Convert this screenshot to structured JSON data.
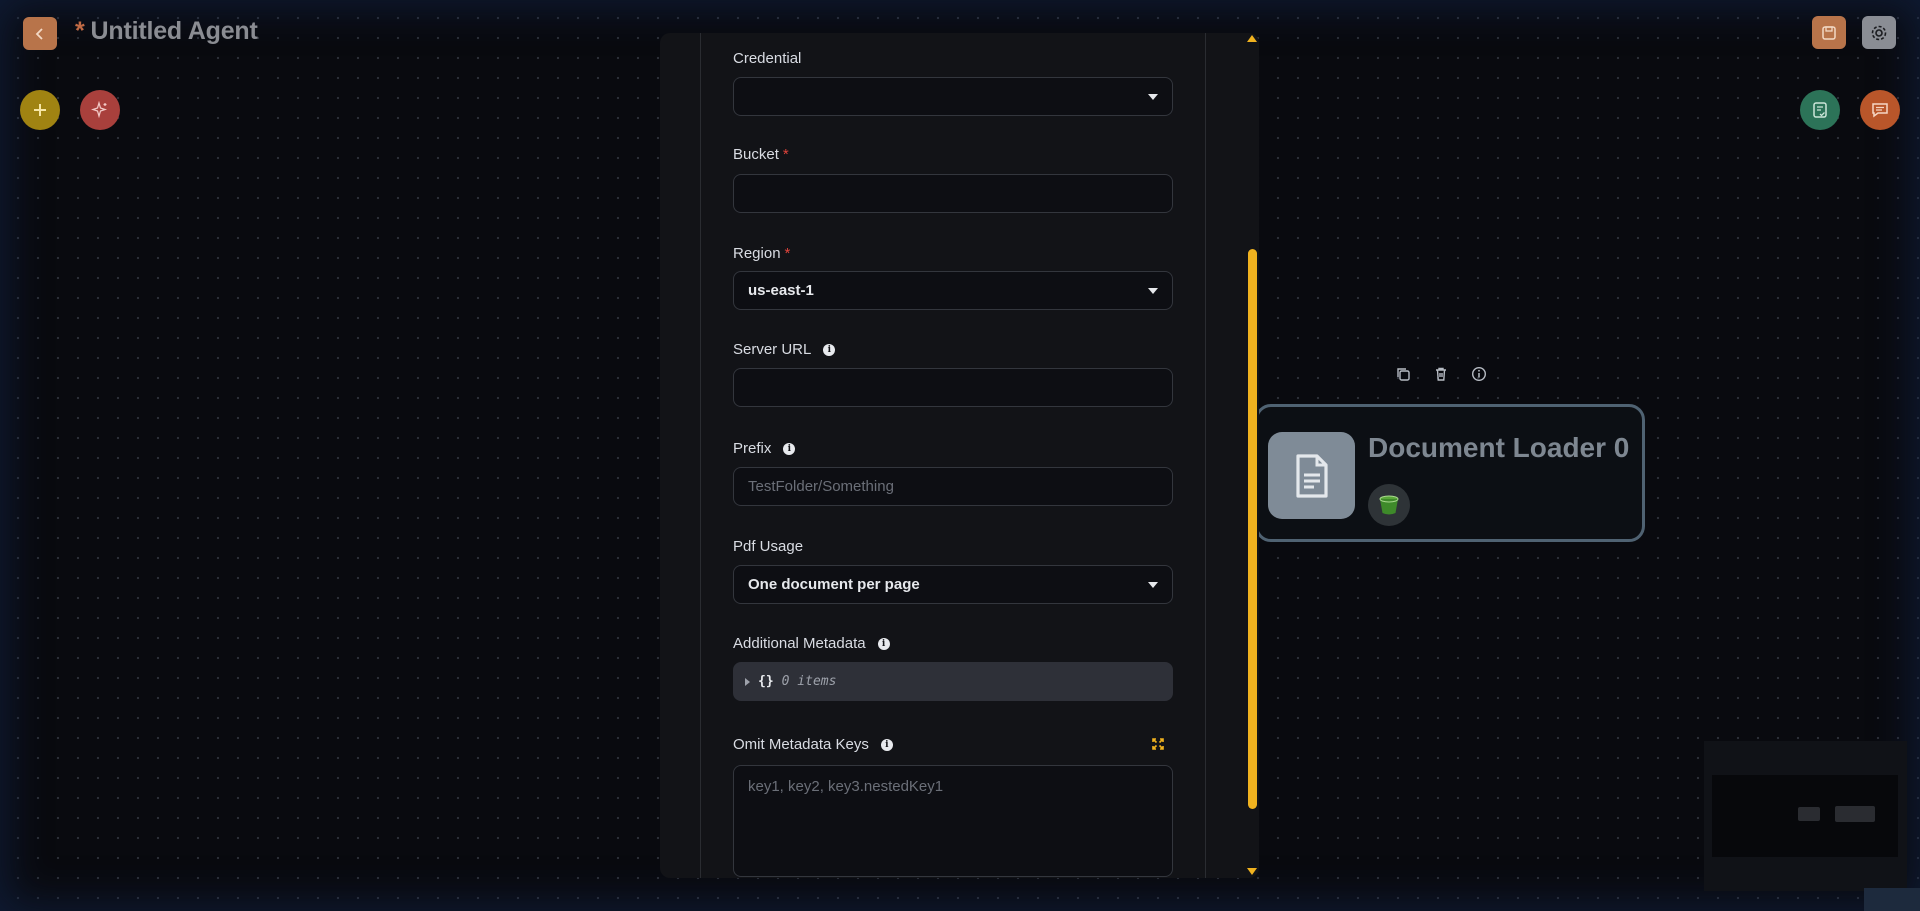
{
  "header": {
    "unsaved_marker": "*",
    "title": "Untitled Agent"
  },
  "colors": {
    "accent": "#f0b21f",
    "back_button": "#b8744a",
    "add_fab": "#a08312",
    "magic_fab": "#a9403c",
    "validate_fab": "#2c7358",
    "chat_fab": "#b9562a",
    "required": "#e0443c"
  },
  "icons": [
    "back-arrow-icon",
    "save-icon",
    "gear-icon",
    "plus-icon",
    "sparkle-icon",
    "checklist-icon",
    "chat-icon",
    "copy-icon",
    "trash-icon",
    "info-icon",
    "document-icon",
    "bucket-icon",
    "expand-icon"
  ],
  "node": {
    "title": "Document Loader 0"
  },
  "form": {
    "credential": {
      "label": "Credential",
      "value": ""
    },
    "bucket": {
      "label": "Bucket",
      "required_mark": "*",
      "value": ""
    },
    "region": {
      "label": "Region",
      "required_mark": "*",
      "value": "us-east-1"
    },
    "server_url": {
      "label": "Server URL",
      "value": ""
    },
    "prefix": {
      "label": "Prefix",
      "placeholder": "TestFolder/Something"
    },
    "pdf_usage": {
      "label": "Pdf Usage",
      "value": "One document per page"
    },
    "additional_metadata": {
      "label": "Additional Metadata",
      "braces": "{}",
      "count_text": "0 items"
    },
    "omit_metadata_keys": {
      "label": "Omit Metadata Keys",
      "placeholder": "key1, key2, key3.nestedKey1"
    }
  }
}
